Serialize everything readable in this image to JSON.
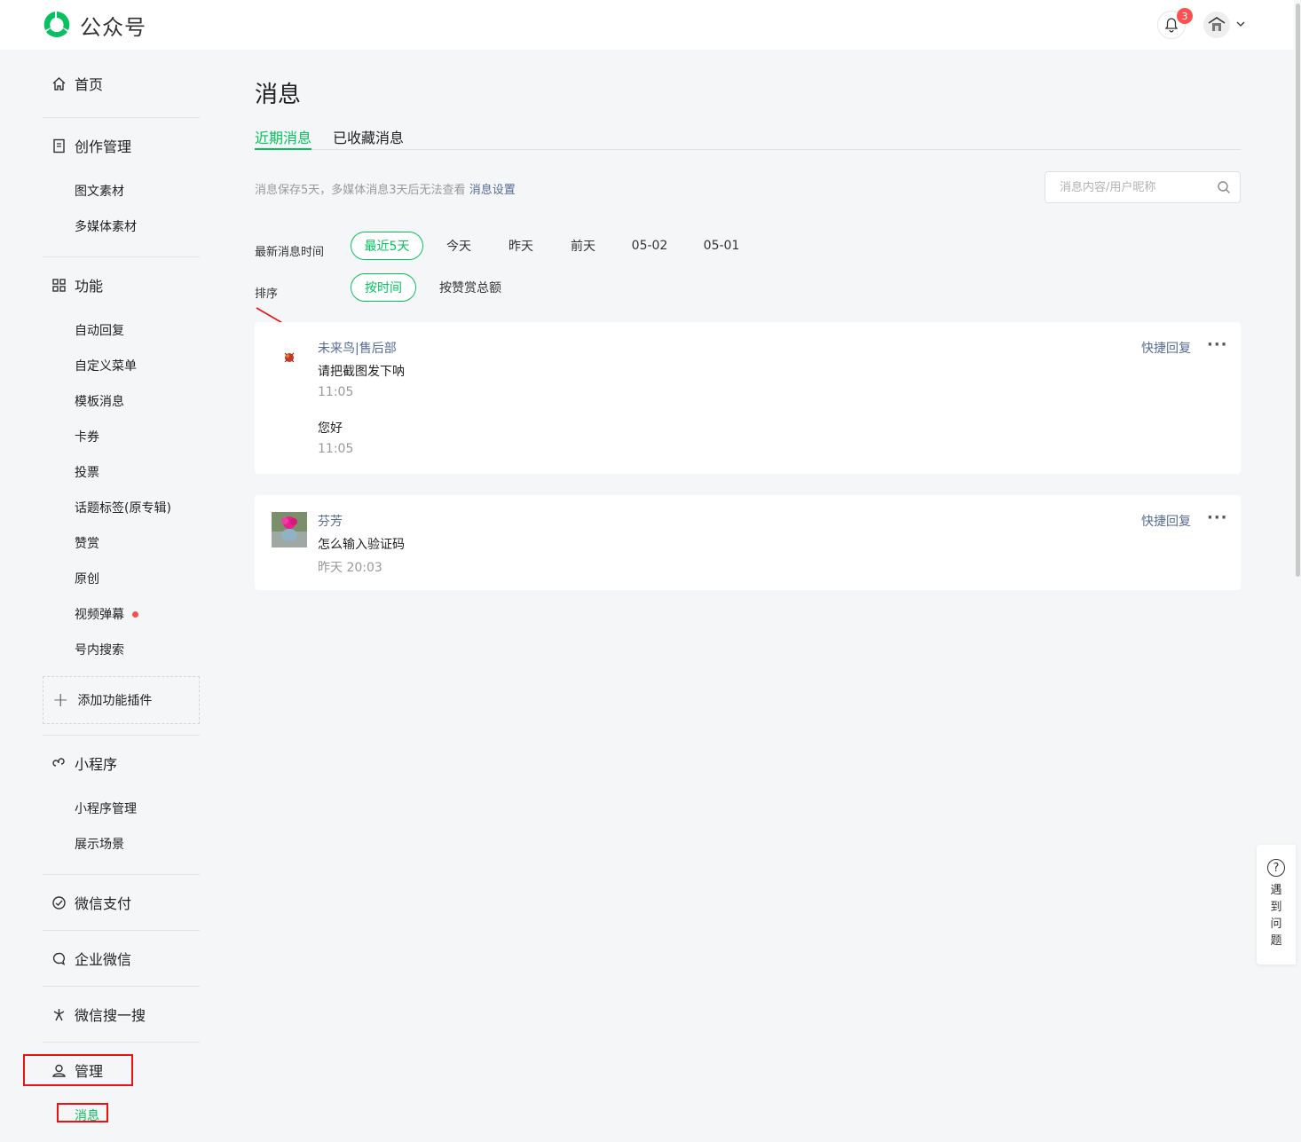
{
  "header": {
    "app_name": "公众号",
    "notification_count": "3",
    "brand_color": "#07c160"
  },
  "sidebar": {
    "home": "首页",
    "create_mgmt": "创作管理",
    "create_items": [
      "图文素材",
      "多媒体素材"
    ],
    "features": "功能",
    "feature_items": [
      "自动回复",
      "自定义菜单",
      "模板消息",
      "卡券",
      "投票",
      "话题标签(原专辑)",
      "赞赏",
      "原创",
      "视频弹幕",
      "号内搜索"
    ],
    "add_plugin": "添加功能插件",
    "mini_program": "小程序",
    "mini_items": [
      "小程序管理",
      "展示场景"
    ],
    "wechat_pay": "微信支付",
    "wecom": "企业微信",
    "wechat_search": "微信搜一搜",
    "manage": "管理",
    "manage_items": [
      "消息"
    ]
  },
  "main": {
    "title": "消息",
    "tabs": [
      "近期消息",
      "已收藏消息"
    ],
    "note": "消息保存5天，多媒体消息3天后无法查看",
    "note_link": "消息设置",
    "search_placeholder": "消息内容/用户昵称",
    "time_filter_label": "最新消息时间",
    "time_filters": [
      "最近5天",
      "今天",
      "昨天",
      "前天",
      "05-02",
      "05-01"
    ],
    "sort_label": "排序",
    "sort_options": [
      "按时间",
      "按赞赏总额"
    ]
  },
  "messages": [
    {
      "name": "未来鸟|售后部",
      "entries": [
        {
          "text": "请把截图发下呐",
          "time": "11:05"
        },
        {
          "text": "您好",
          "time": "11:05"
        }
      ],
      "quick_reply": "快捷回复",
      "more": "···"
    },
    {
      "name": "芬芳",
      "entries": [
        {
          "text": "怎么输入验证码",
          "time": "昨天 20:03"
        }
      ],
      "quick_reply": "快捷回复",
      "more": "···"
    }
  ],
  "help": {
    "icon_glyph": "?",
    "label": "遇到问题"
  }
}
